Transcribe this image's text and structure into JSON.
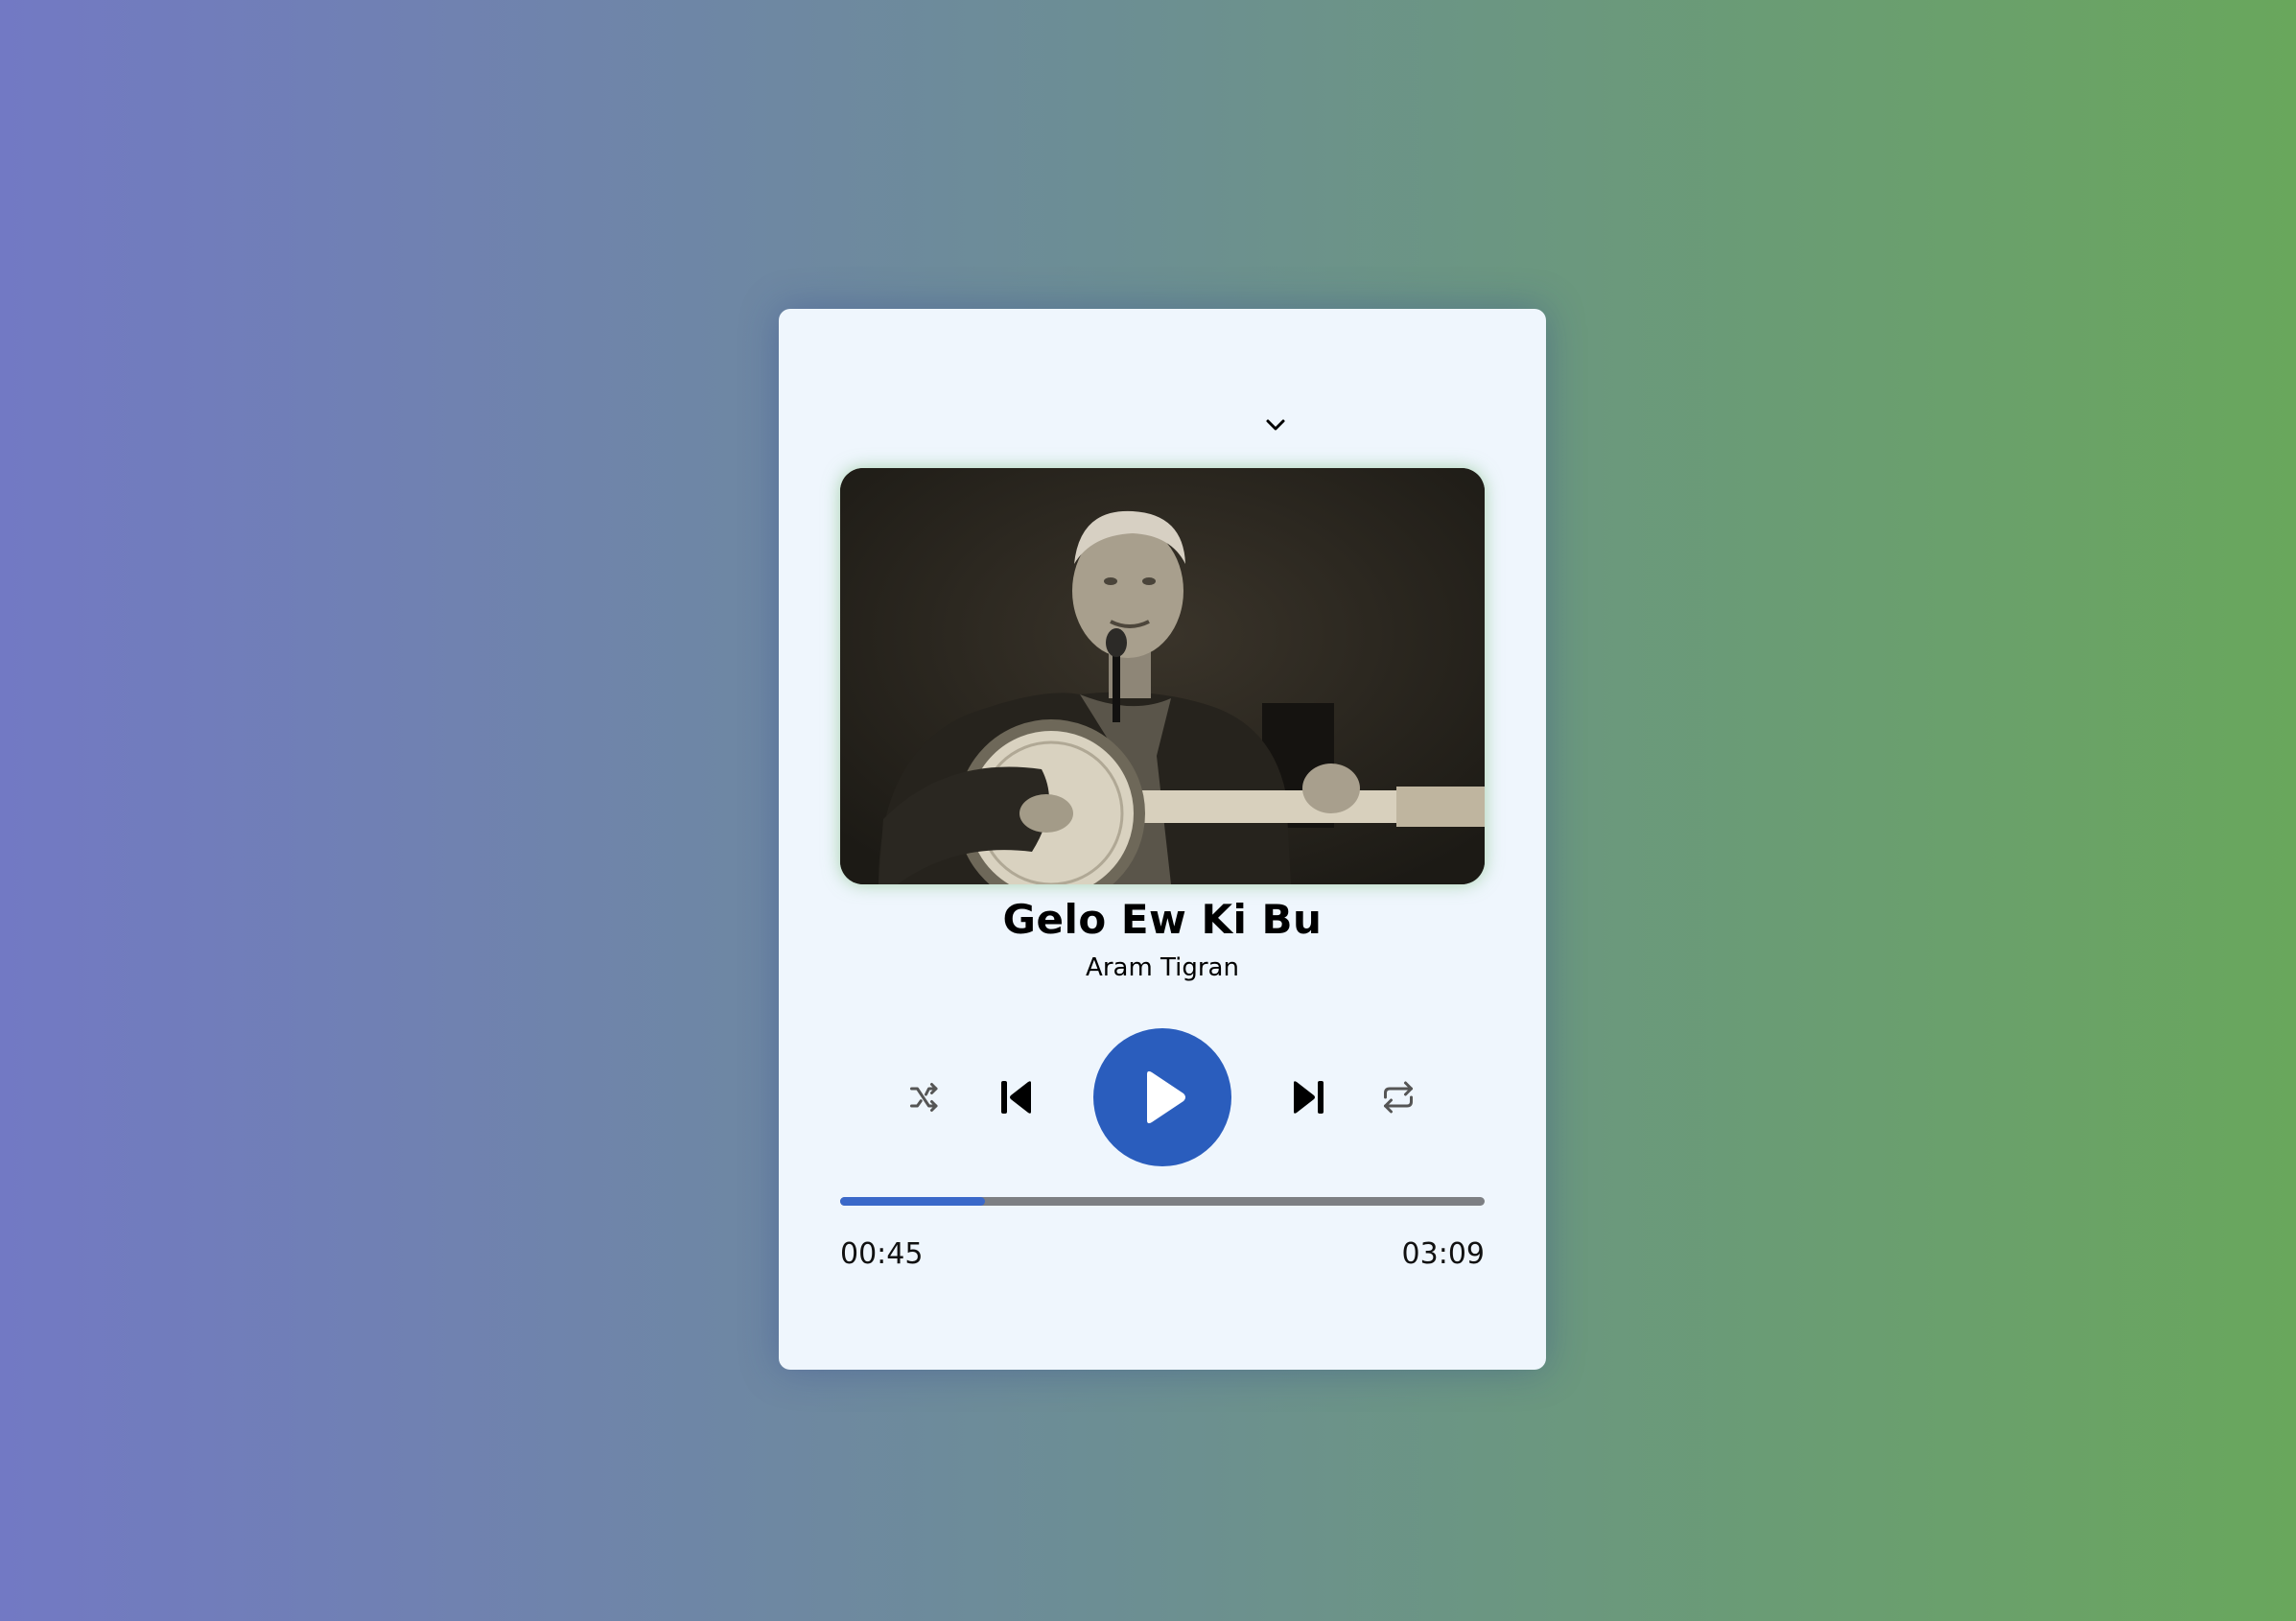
{
  "player": {
    "collapse_icon": "chevron-down-icon",
    "artwork_icon": "album-art",
    "song": {
      "title": "Gelo Ew Ki Bu",
      "artist": "Aram Tigran"
    },
    "controls": {
      "shuffle_icon": "shuffle-icon",
      "previous_icon": "skip-previous-icon",
      "play_icon": "play-icon",
      "next_icon": "skip-next-icon",
      "repeat_icon": "repeat-icon"
    },
    "progress": {
      "fraction": 0.225,
      "current_time": "00:45",
      "total_time": "03:09"
    }
  },
  "colors": {
    "accent": "#2a5dbd",
    "progress_fill": "#3a68c9",
    "progress_track": "#7d7f83",
    "card_background": "#eff6fd",
    "background_left": "#7279c4",
    "background_right": "#69a75c"
  }
}
